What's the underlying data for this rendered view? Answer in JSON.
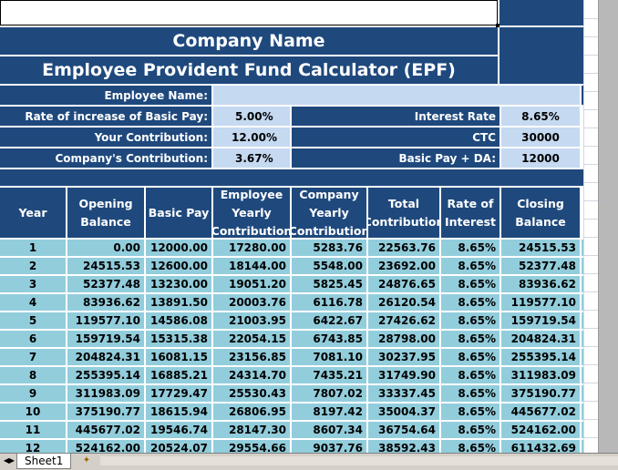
{
  "header": {
    "company": "Company Name",
    "title": "Employee Provident Fund Calculator (EPF)"
  },
  "inputs": {
    "employee_name_label": "Employee Name:",
    "employee_name_value": "",
    "basic_pay_increase_label": "Rate of increase of Basic Pay:",
    "basic_pay_increase_value": "5.00%",
    "your_contribution_label": "Your Contribution:",
    "your_contribution_value": "12.00%",
    "company_contribution_label": "Company's Contribution:",
    "company_contribution_value": "3.67%",
    "interest_rate_label": "Interest Rate",
    "interest_rate_value": "8.65%",
    "ctc_label": "CTC",
    "ctc_value": "30000",
    "basic_da_label": "Basic Pay + DA:",
    "basic_da_value": "12000"
  },
  "table": {
    "columns": [
      "Year",
      "Opening Balance",
      "Basic Pay",
      "Employee Yearly Contribution",
      "Company Yearly Contribution",
      "Total Contribution",
      "Rate of Interest",
      "Closing Balance"
    ],
    "rows": [
      [
        "1",
        "0.00",
        "12000.00",
        "17280.00",
        "5283.76",
        "22563.76",
        "8.65%",
        "24515.53"
      ],
      [
        "2",
        "24515.53",
        "12600.00",
        "18144.00",
        "5548.00",
        "23692.00",
        "8.65%",
        "52377.48"
      ],
      [
        "3",
        "52377.48",
        "13230.00",
        "19051.20",
        "5825.45",
        "24876.65",
        "8.65%",
        "83936.62"
      ],
      [
        "4",
        "83936.62",
        "13891.50",
        "20003.76",
        "6116.78",
        "26120.54",
        "8.65%",
        "119577.10"
      ],
      [
        "5",
        "119577.10",
        "14586.08",
        "21003.95",
        "6422.67",
        "27426.62",
        "8.65%",
        "159719.54"
      ],
      [
        "6",
        "159719.54",
        "15315.38",
        "22054.15",
        "6743.85",
        "28798.00",
        "8.65%",
        "204824.31"
      ],
      [
        "7",
        "204824.31",
        "16081.15",
        "23156.85",
        "7081.10",
        "30237.95",
        "8.65%",
        "255395.14"
      ],
      [
        "8",
        "255395.14",
        "16885.21",
        "24314.70",
        "7435.21",
        "31749.90",
        "8.65%",
        "311983.09"
      ],
      [
        "9",
        "311983.09",
        "17729.47",
        "25530.43",
        "7807.02",
        "33337.45",
        "8.65%",
        "375190.77"
      ],
      [
        "10",
        "375190.77",
        "18615.94",
        "26806.95",
        "8197.42",
        "35004.37",
        "8.65%",
        "445677.02"
      ],
      [
        "11",
        "445677.02",
        "19546.74",
        "28147.30",
        "8607.34",
        "36754.64",
        "8.65%",
        "524162.00"
      ],
      [
        "12",
        "524162.00",
        "20524.07",
        "29554.66",
        "9037.76",
        "38592.43",
        "8.65%",
        "611432.69"
      ]
    ]
  },
  "sheet_tabs": {
    "active": "Sheet1"
  },
  "colors": {
    "navy": "#1f497d",
    "light_blue": "#c5d9f1",
    "teal": "#92cddc"
  }
}
